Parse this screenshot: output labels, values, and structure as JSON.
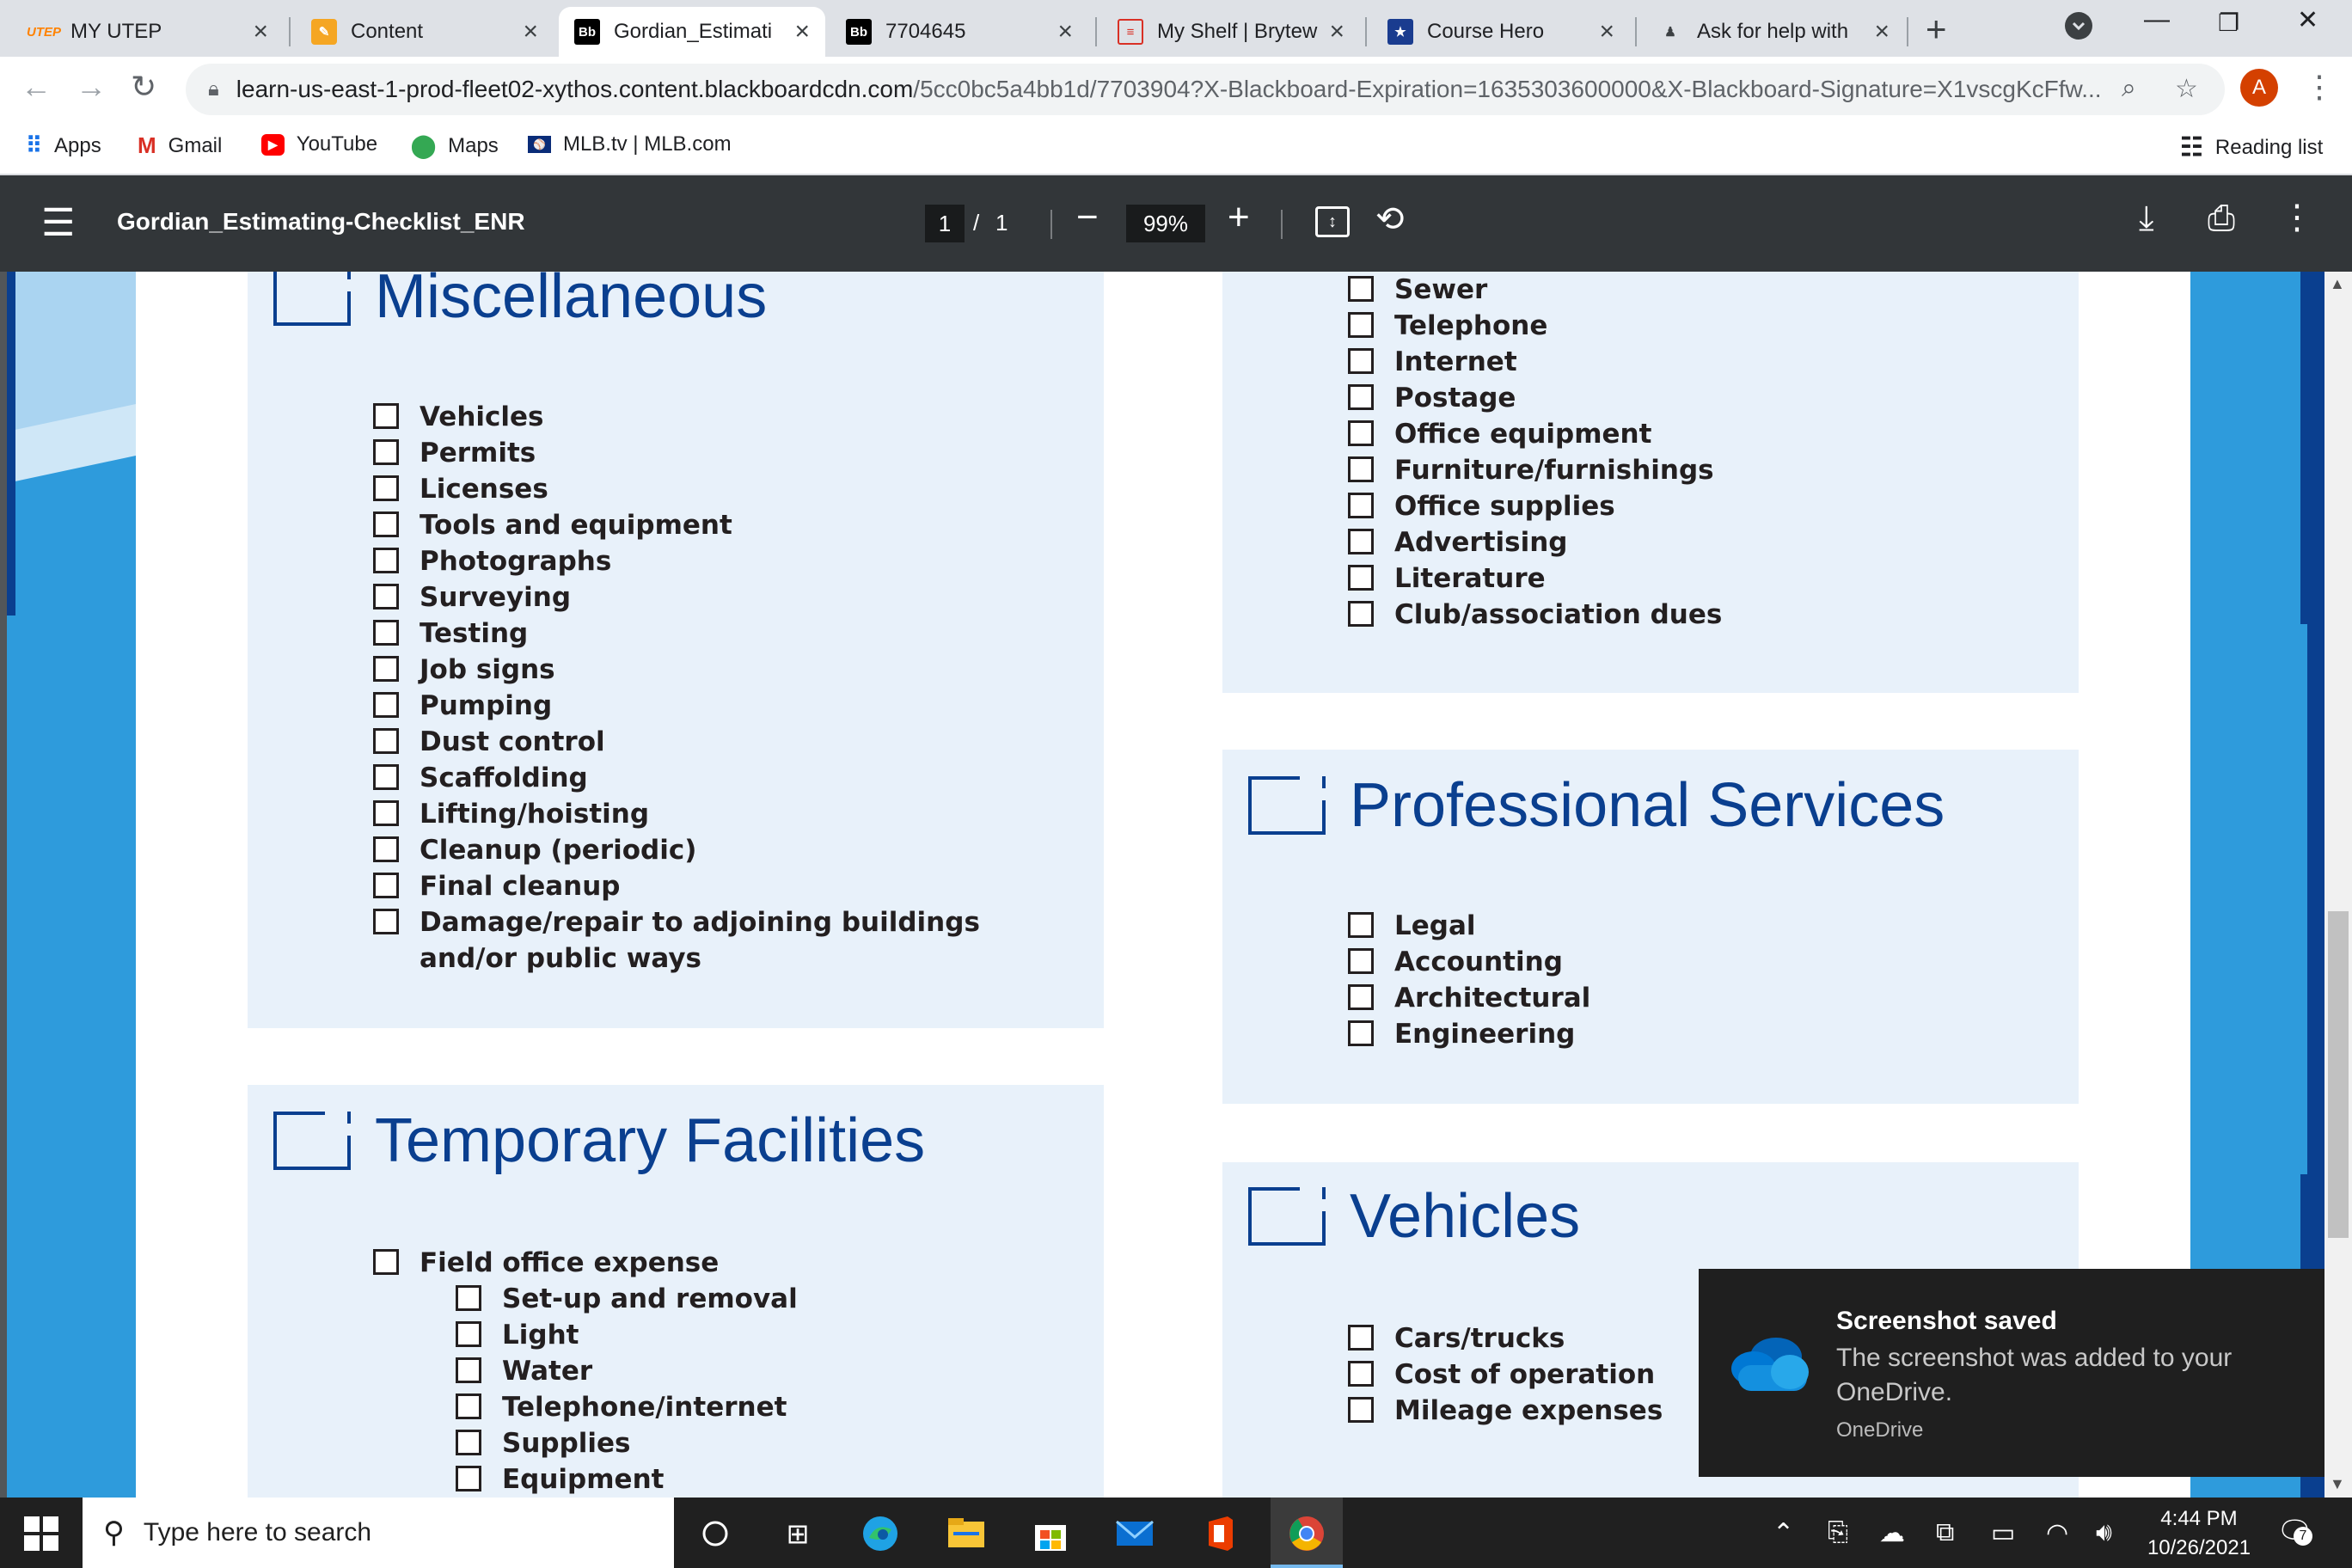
{
  "browser": {
    "tabs": [
      {
        "title": "MY UTEP",
        "favicon": "UTEP"
      },
      {
        "title": "Content",
        "favicon": "pencil"
      },
      {
        "title": "Gordian_Estimati",
        "favicon": "Bb",
        "active": true
      },
      {
        "title": "7704645",
        "favicon": "Bb"
      },
      {
        "title": "My Shelf | Brytew",
        "favicon": "doc"
      },
      {
        "title": "Course Hero",
        "favicon": "star"
      },
      {
        "title": "Ask for help with",
        "favicon": "user"
      }
    ],
    "url_host": "learn-us-east-1-prod-fleet02-xythos.content.blackboardcdn.com",
    "url_rest": "/5cc0bc5a4bb1d/7703904?X-Blackboard-Expiration=1635303600000&X-Blackboard-Signature=X1vscgKcFfw...",
    "profile_initial": "A",
    "bookmarks": [
      {
        "label": "Apps",
        "icon": "apps-grid-icon"
      },
      {
        "label": "Gmail",
        "icon": "gmail-icon"
      },
      {
        "label": "YouTube",
        "icon": "youtube-icon"
      },
      {
        "label": "Maps",
        "icon": "maps-pin-icon"
      },
      {
        "label": "MLB.tv | MLB.com",
        "icon": "mlb-icon"
      }
    ],
    "reading_list": "Reading list"
  },
  "pdf_viewer": {
    "title": "Gordian_Estimating-Checklist_ENR",
    "current_page": "1",
    "page_sep": "/",
    "total_pages": "1",
    "zoom": "99%"
  },
  "document": {
    "misc": {
      "title": "Miscellaneous",
      "items": [
        "Vehicles",
        "Permits",
        "Licenses",
        "Tools and equipment",
        "Photographs",
        "Surveying",
        "Testing",
        "Job signs",
        "Pumping",
        "Dust control",
        "Scaffolding",
        "Lifting/hoisting",
        "Cleanup (periodic)",
        "Final cleanup",
        "Damage/repair to adjoining buildings"
      ],
      "item_continuation": "and/or public ways"
    },
    "temporary": {
      "title": "Temporary Facilities",
      "items": [
        "Field office expense"
      ],
      "sub_items": [
        "Set-up and removal",
        "Light",
        "Water",
        "Telephone/internet",
        "Supplies",
        "Equipment"
      ]
    },
    "office": {
      "items": [
        "Sewer",
        "Telephone",
        "Internet",
        "Postage",
        "Office equipment",
        "Furniture/furnishings",
        "Office supplies",
        "Advertising",
        "Literature",
        "Club/association dues"
      ]
    },
    "professional": {
      "title": "Professional Services",
      "items": [
        "Legal",
        "Accounting",
        "Architectural",
        "Engineering"
      ]
    },
    "vehicles": {
      "title": "Vehicles",
      "items": [
        "Cars/trucks",
        "Cost of operation",
        "Mileage expenses"
      ]
    }
  },
  "toast": {
    "title": "Screenshot saved",
    "body": "The screenshot was added to your OneDrive.",
    "app": "OneDrive"
  },
  "taskbar": {
    "search_placeholder": "Type here to search",
    "time": "4:44 PM",
    "date": "10/26/2021",
    "notification_count": "7"
  }
}
